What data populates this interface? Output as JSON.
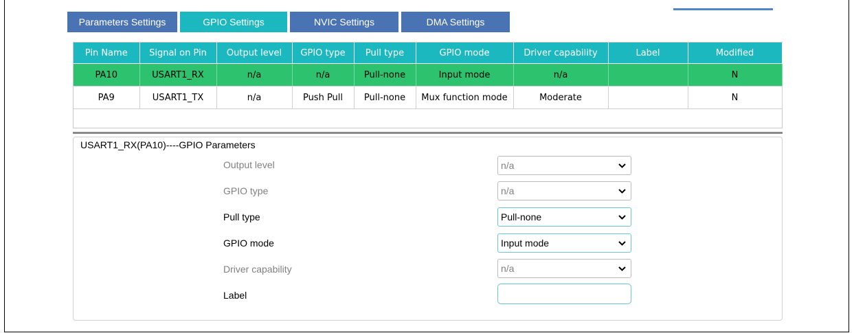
{
  "tabs": [
    "Parameters Settings",
    "GPIO Settings",
    "NVIC Settings",
    "DMA Settings"
  ],
  "active_tab": "GPIO Settings",
  "table": {
    "columns": [
      "Pin Name",
      "Signal on Pin",
      "Output level",
      "GPIO type",
      "Pull type",
      "GPIO mode",
      "Driver capability",
      "Label",
      "Modified"
    ],
    "rows": [
      [
        "PA10",
        "USART1_RX",
        "n/a",
        "n/a",
        "Pull-none",
        "Input mode",
        "n/a",
        "",
        "N"
      ],
      [
        "PA9",
        "USART1_TX",
        "n/a",
        "Push Pull",
        "Pull-none",
        "Mux function mode",
        "Moderate",
        "",
        "N"
      ]
    ],
    "selected_row": 0
  },
  "params": {
    "title": "USART1_RX(PA10)----GPIO Parameters",
    "fields": [
      {
        "label": "Output level",
        "value": "n/a",
        "enabled": false
      },
      {
        "label": "GPIO type",
        "value": "n/a",
        "enabled": false
      },
      {
        "label": "Pull type",
        "value": "Pull-none",
        "enabled": true
      },
      {
        "label": "GPIO mode",
        "value": "Input mode",
        "enabled": true
      },
      {
        "label": "Driver capability",
        "value": "n/a",
        "enabled": false
      }
    ],
    "label_field": {
      "label": "Label",
      "value": ""
    }
  },
  "colors": {
    "tab_blue": "#4a73b4",
    "tab_active": "#1cb8c0",
    "selected_row": "#2cc26e"
  }
}
